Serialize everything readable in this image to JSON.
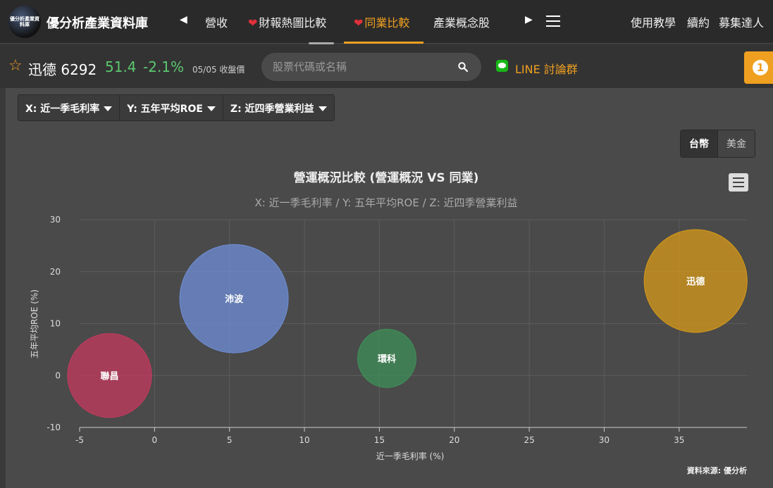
{
  "nav": {
    "brand": "優分析產業資料庫",
    "logo_text": "優分析產業資料庫",
    "items": [
      {
        "label": "營收",
        "heart": false,
        "active": false
      },
      {
        "label": "財報熱圖比較",
        "heart": true,
        "active": false
      },
      {
        "label": "同業比較",
        "heart": true,
        "active": true
      },
      {
        "label": "產業概念股",
        "heart": false,
        "active": false
      }
    ],
    "right_links": [
      "使用教學",
      "續約",
      "募集達人"
    ]
  },
  "stock": {
    "name": "迅德 6292",
    "price": "51.4",
    "change": "-2.1%",
    "date": "05/05 收盤價"
  },
  "search": {
    "placeholder": "股票代碼或名稱"
  },
  "line_group": "LINE 討論群",
  "notice_count": "1",
  "dropdowns": [
    "X: 近一季毛利率",
    "Y: 五年平均ROE",
    "Z: 近四季營業利益"
  ],
  "currency": {
    "options": [
      "台幣",
      "美金"
    ],
    "selected": "台幣"
  },
  "colors": {
    "accent": "#f0a020",
    "up_down": "#5cc870"
  },
  "chart_data": {
    "type": "bubble",
    "title": "營運概況比較 (營運概況 VS 同業)",
    "subtitle": "X: 近一季毛利率 / Y: 五年平均ROE / Z: 近四季營業利益",
    "xlabel": "近一季毛利率 (%)",
    "ylabel": "五年平均ROE (%)",
    "xlim": [
      -5,
      39
    ],
    "ylim": [
      -10,
      30
    ],
    "xticks": [
      -5,
      0,
      5,
      10,
      15,
      20,
      25,
      30,
      35
    ],
    "yticks": [
      -10,
      0,
      10,
      20,
      30
    ],
    "grid": true,
    "credits": "資料來源: 優分析",
    "points": [
      {
        "name": "聯昌",
        "x": -3,
        "y": 0,
        "z": 0.6,
        "color": "#c43a5e"
      },
      {
        "name": "沛波",
        "x": 5.3,
        "y": 14.8,
        "z": 1.0,
        "color": "#6f8fd8"
      },
      {
        "name": "環科",
        "x": 15.5,
        "y": 3.3,
        "z": 0.29,
        "color": "#3f8f58"
      },
      {
        "name": "迅德",
        "x": 36.1,
        "y": 18.2,
        "z": 0.9,
        "color": "#d89a18"
      }
    ]
  }
}
